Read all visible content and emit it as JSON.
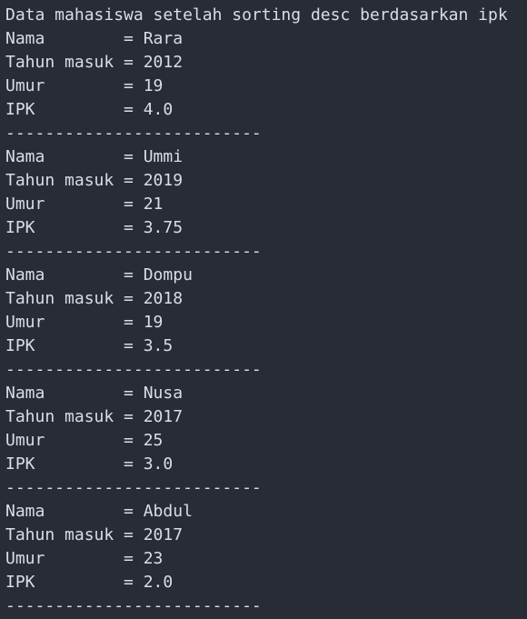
{
  "colors": {
    "background": "#282c34",
    "text": "#d8dee9"
  },
  "terminal": {
    "header": "Data mahasiswa setelah sorting desc berdasarkan ipk",
    "separator": "--------------------------",
    "records": [
      {
        "nama": "Nama        = Rara",
        "tahun": "Tahun masuk = 2012",
        "umur": "Umur        = 19",
        "ipk": "IPK         = 4.0"
      },
      {
        "nama": "Nama        = Ummi",
        "tahun": "Tahun masuk = 2019",
        "umur": "Umur        = 21",
        "ipk": "IPK         = 3.75"
      },
      {
        "nama": "Nama        = Dompu",
        "tahun": "Tahun masuk = 2018",
        "umur": "Umur        = 19",
        "ipk": "IPK         = 3.5"
      },
      {
        "nama": "Nama        = Nusa",
        "tahun": "Tahun masuk = 2017",
        "umur": "Umur        = 25",
        "ipk": "IPK         = 3.0"
      },
      {
        "nama": "Nama        = Abdul",
        "tahun": "Tahun masuk = 2017",
        "umur": "Umur        = 23",
        "ipk": "IPK         = 2.0"
      }
    ]
  }
}
